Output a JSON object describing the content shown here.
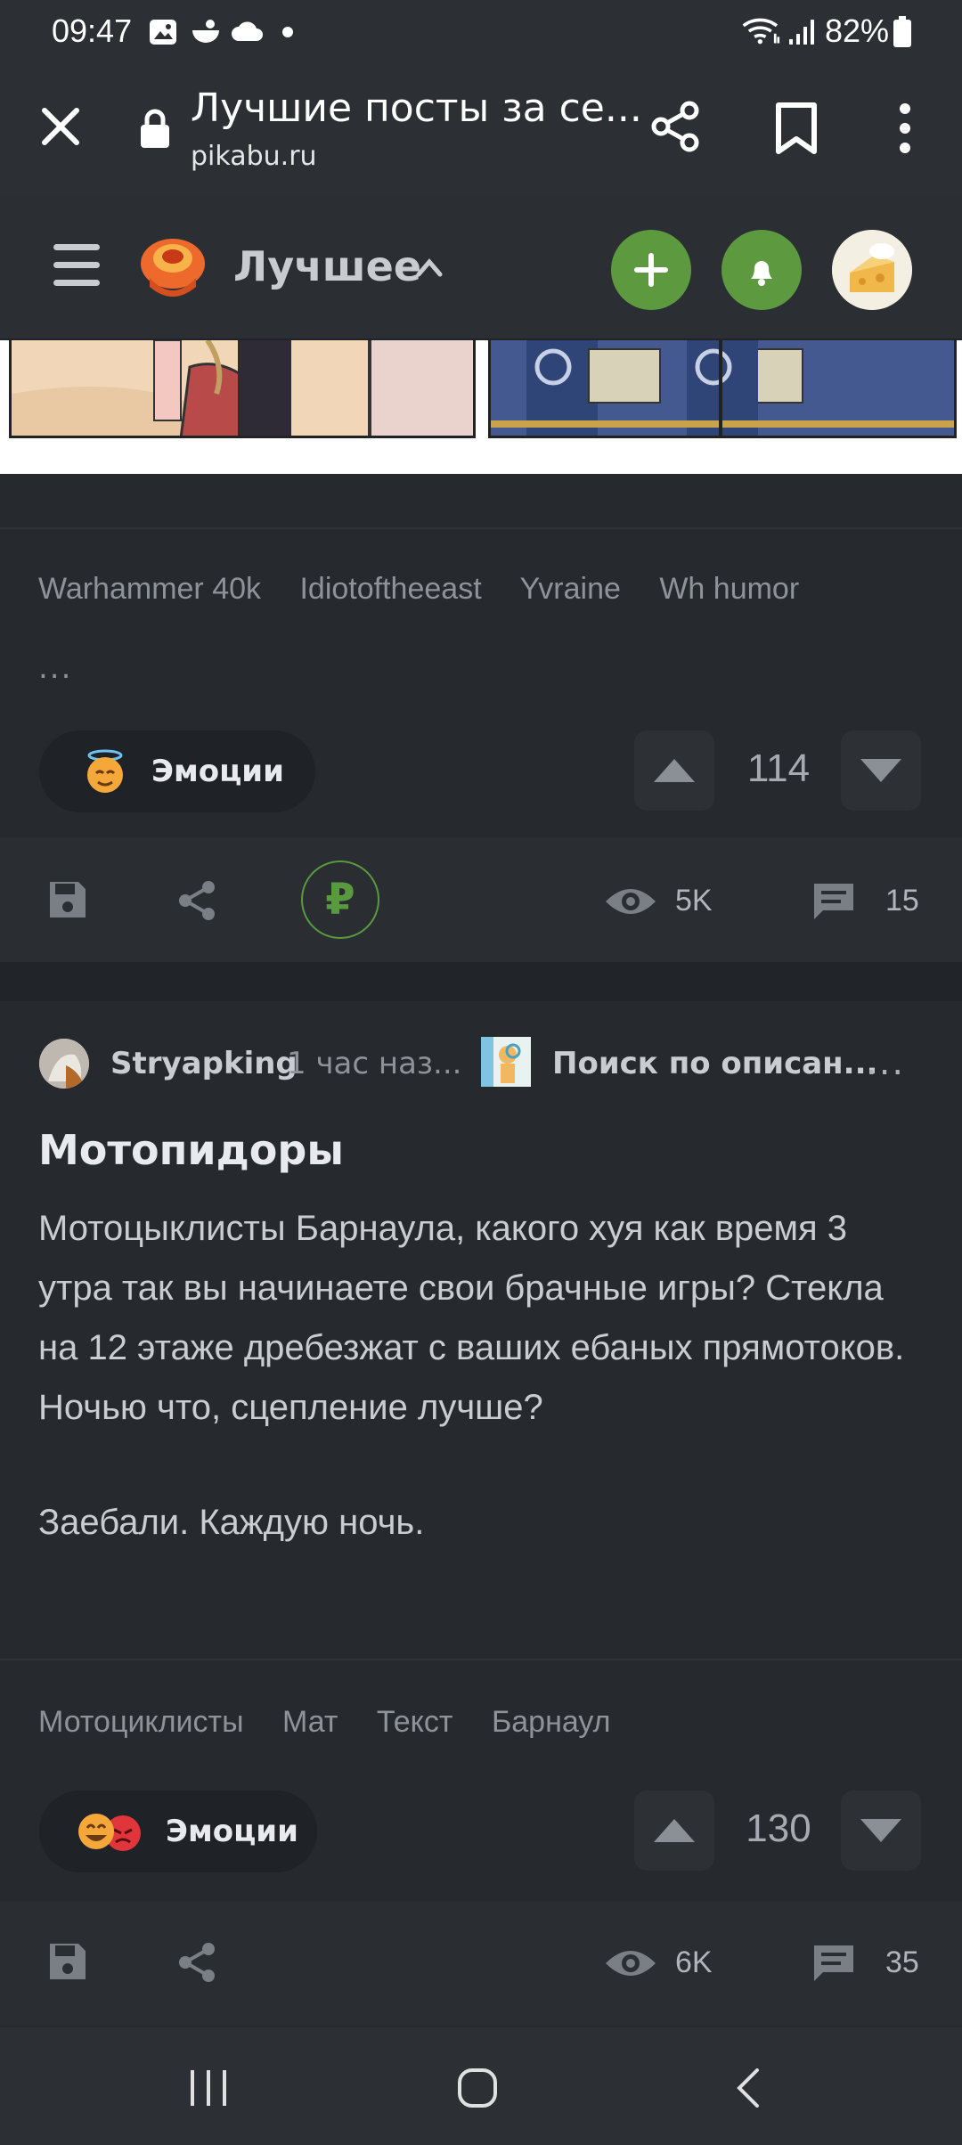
{
  "status_bar": {
    "time": "09:47",
    "battery": "82%"
  },
  "browser": {
    "title": "Лучшие посты за се...",
    "url": "pikabu.ru"
  },
  "site_header": {
    "section": "Лучшее"
  },
  "post1": {
    "tags": [
      "Warhammer 40k",
      "Idiotoftheeast",
      "Yvraine",
      "Wh humor"
    ],
    "tags_more": "...",
    "emotions_label": "Эмоции",
    "rating": "114",
    "views": "5K",
    "comments": "15",
    "donate_symbol": "₽"
  },
  "post2": {
    "author": "Stryapking",
    "time": "1 час наз...",
    "community": "Поиск по описан...",
    "more": "...",
    "title": "Мотопидоры",
    "body_paragraph1": "Мотоцыклисты Барнаула, какого хуя как время 3 утра так вы начинаете свои брачные игры? Стекла на 12 этаже дребезжат с ваших ебаных прямотоков. Ночью что, сцепление лучше?",
    "body_paragraph2": "Заебали. Каждую ночь.",
    "tags": [
      "Мотоциклисты",
      "Мат",
      "Текст",
      "Барнаул"
    ],
    "emotions_label": "Эмоции",
    "rating": "130",
    "views": "6K",
    "comments": "35"
  },
  "colors": {
    "background": "#262a2f",
    "accent_green": "#5d9a3f",
    "text": "#c9ccd1",
    "muted": "#8e939a"
  }
}
